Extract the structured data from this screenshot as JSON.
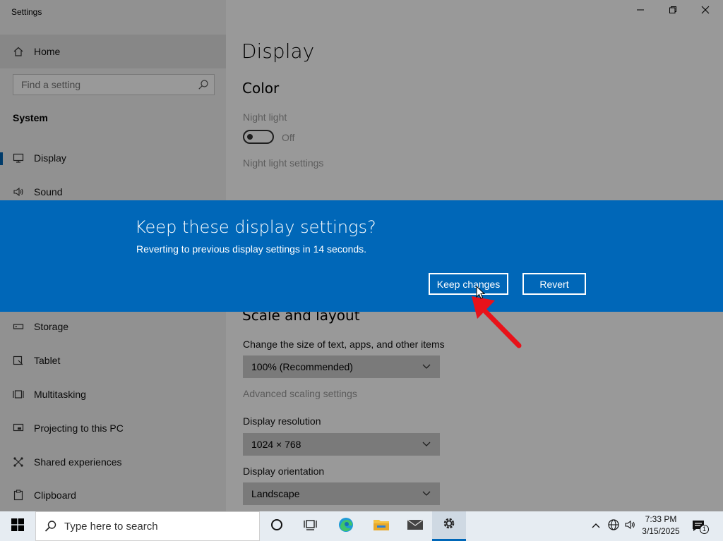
{
  "window": {
    "title": "Settings",
    "minimize_icon": "minimize-icon",
    "maximize_icon": "maximize-icon",
    "close_icon": "close-icon"
  },
  "sidebar": {
    "home_label": "Home",
    "search_placeholder": "Find a setting",
    "section_title": "System",
    "items": [
      {
        "label": "Display",
        "icon": "monitor-icon",
        "active": true
      },
      {
        "label": "Sound",
        "icon": "speaker-icon"
      },
      {
        "label": "Storage",
        "icon": "storage-icon"
      },
      {
        "label": "Tablet",
        "icon": "tablet-icon"
      },
      {
        "label": "Multitasking",
        "icon": "multitasking-icon"
      },
      {
        "label": "Projecting to this PC",
        "icon": "projecting-icon"
      },
      {
        "label": "Shared experiences",
        "icon": "shared-icon"
      },
      {
        "label": "Clipboard",
        "icon": "clipboard-icon"
      }
    ]
  },
  "main": {
    "title": "Display",
    "color_heading": "Color",
    "night_light_label": "Night light",
    "night_light_state": "Off",
    "night_light_link": "Night light settings",
    "scale_heading": "Scale and layout",
    "scale_label": "Change the size of text, apps, and other items",
    "scale_value": "100% (Recommended)",
    "advanced_link": "Advanced scaling settings",
    "resolution_label": "Display resolution",
    "resolution_value": "1024 × 768",
    "orientation_label": "Display orientation",
    "orientation_value": "Landscape"
  },
  "dialog": {
    "title": "Keep these display settings?",
    "message": "Reverting to previous display settings in 14 seconds.",
    "keep_label": "Keep changes",
    "revert_label": "Revert"
  },
  "taskbar": {
    "search_placeholder": "Type here to search",
    "time": "7:33 PM",
    "date": "3/15/2025",
    "notification_count": "1"
  },
  "colors": {
    "accent": "#0067b8",
    "annotation_arrow": "#e8121a"
  }
}
